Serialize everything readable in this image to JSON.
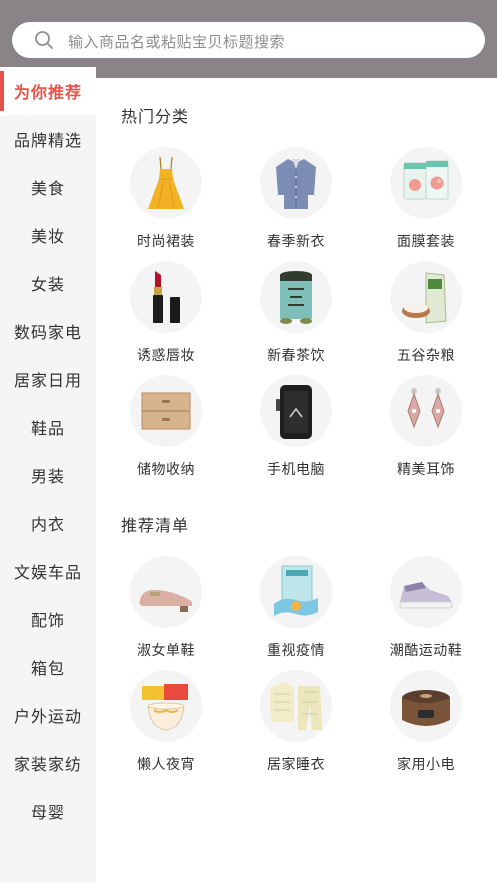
{
  "search": {
    "placeholder": "输入商品名或粘贴宝贝标题搜索",
    "icon": "search-icon"
  },
  "sidebar": {
    "accent_color": "#e8524a",
    "items": [
      {
        "label": "为你推荐",
        "active": true
      },
      {
        "label": "品牌精选"
      },
      {
        "label": "美食"
      },
      {
        "label": "美妆"
      },
      {
        "label": "女装"
      },
      {
        "label": "数码家电"
      },
      {
        "label": "居家日用"
      },
      {
        "label": "鞋品"
      },
      {
        "label": "男装"
      },
      {
        "label": "内衣"
      },
      {
        "label": "文娱车品"
      },
      {
        "label": "配饰"
      },
      {
        "label": "箱包"
      },
      {
        "label": "户外运动"
      },
      {
        "label": "家装家纺"
      },
      {
        "label": "母婴"
      }
    ]
  },
  "sections": {
    "hot": {
      "title": "热门分类",
      "items": [
        {
          "label": "时尚裙装",
          "icon": "dress-icon"
        },
        {
          "label": "春季新衣",
          "icon": "shirt-icon"
        },
        {
          "label": "面膜套装",
          "icon": "face-mask-icon"
        },
        {
          "label": "诱惑唇妆",
          "icon": "lipstick-icon"
        },
        {
          "label": "新春茶饮",
          "icon": "tea-can-icon"
        },
        {
          "label": "五谷杂粮",
          "icon": "rice-bag-icon"
        },
        {
          "label": "储物收纳",
          "icon": "drawer-box-icon"
        },
        {
          "label": "手机电脑",
          "icon": "phone-icon"
        },
        {
          "label": "精美耳饰",
          "icon": "earrings-icon"
        }
      ]
    },
    "recommend": {
      "title": "推荐清单",
      "items": [
        {
          "label": "淑女单鞋",
          "icon": "flat-shoe-icon"
        },
        {
          "label": "重视疫情",
          "icon": "face-masks-box-icon"
        },
        {
          "label": "潮酷运动鞋",
          "icon": "sneaker-icon"
        },
        {
          "label": "懒人夜宵",
          "icon": "instant-noodles-icon"
        },
        {
          "label": "居家睡衣",
          "icon": "pajamas-icon"
        },
        {
          "label": "家用小电",
          "icon": "rice-cooker-icon"
        }
      ]
    }
  }
}
